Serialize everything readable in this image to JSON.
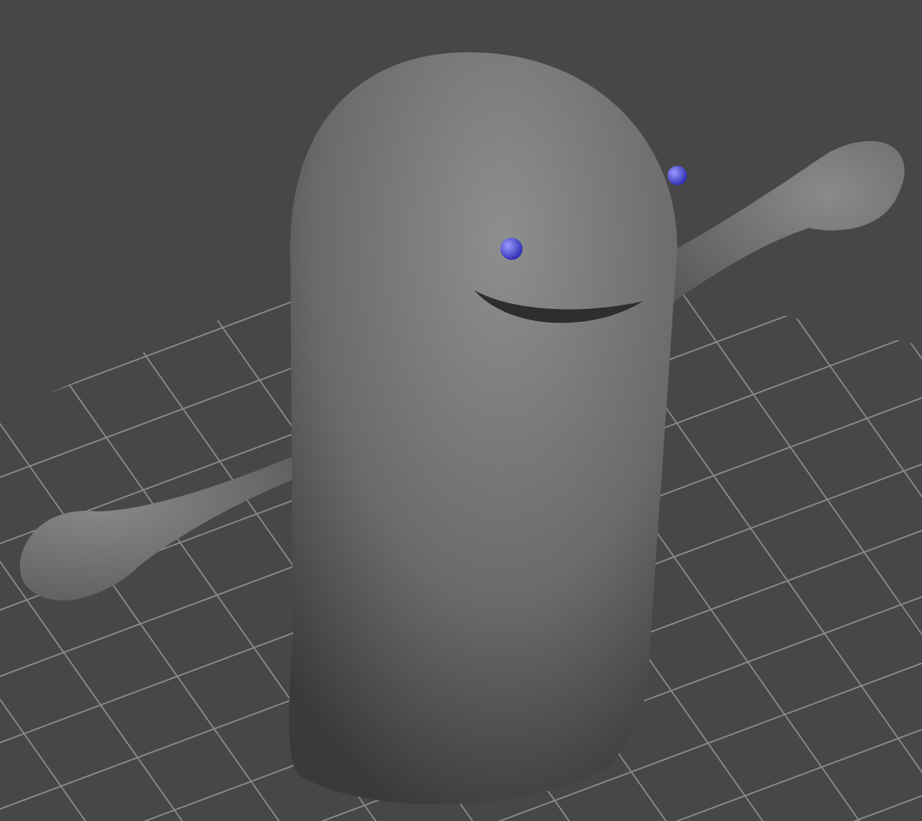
{
  "scene": {
    "kind": "character"
  }
}
